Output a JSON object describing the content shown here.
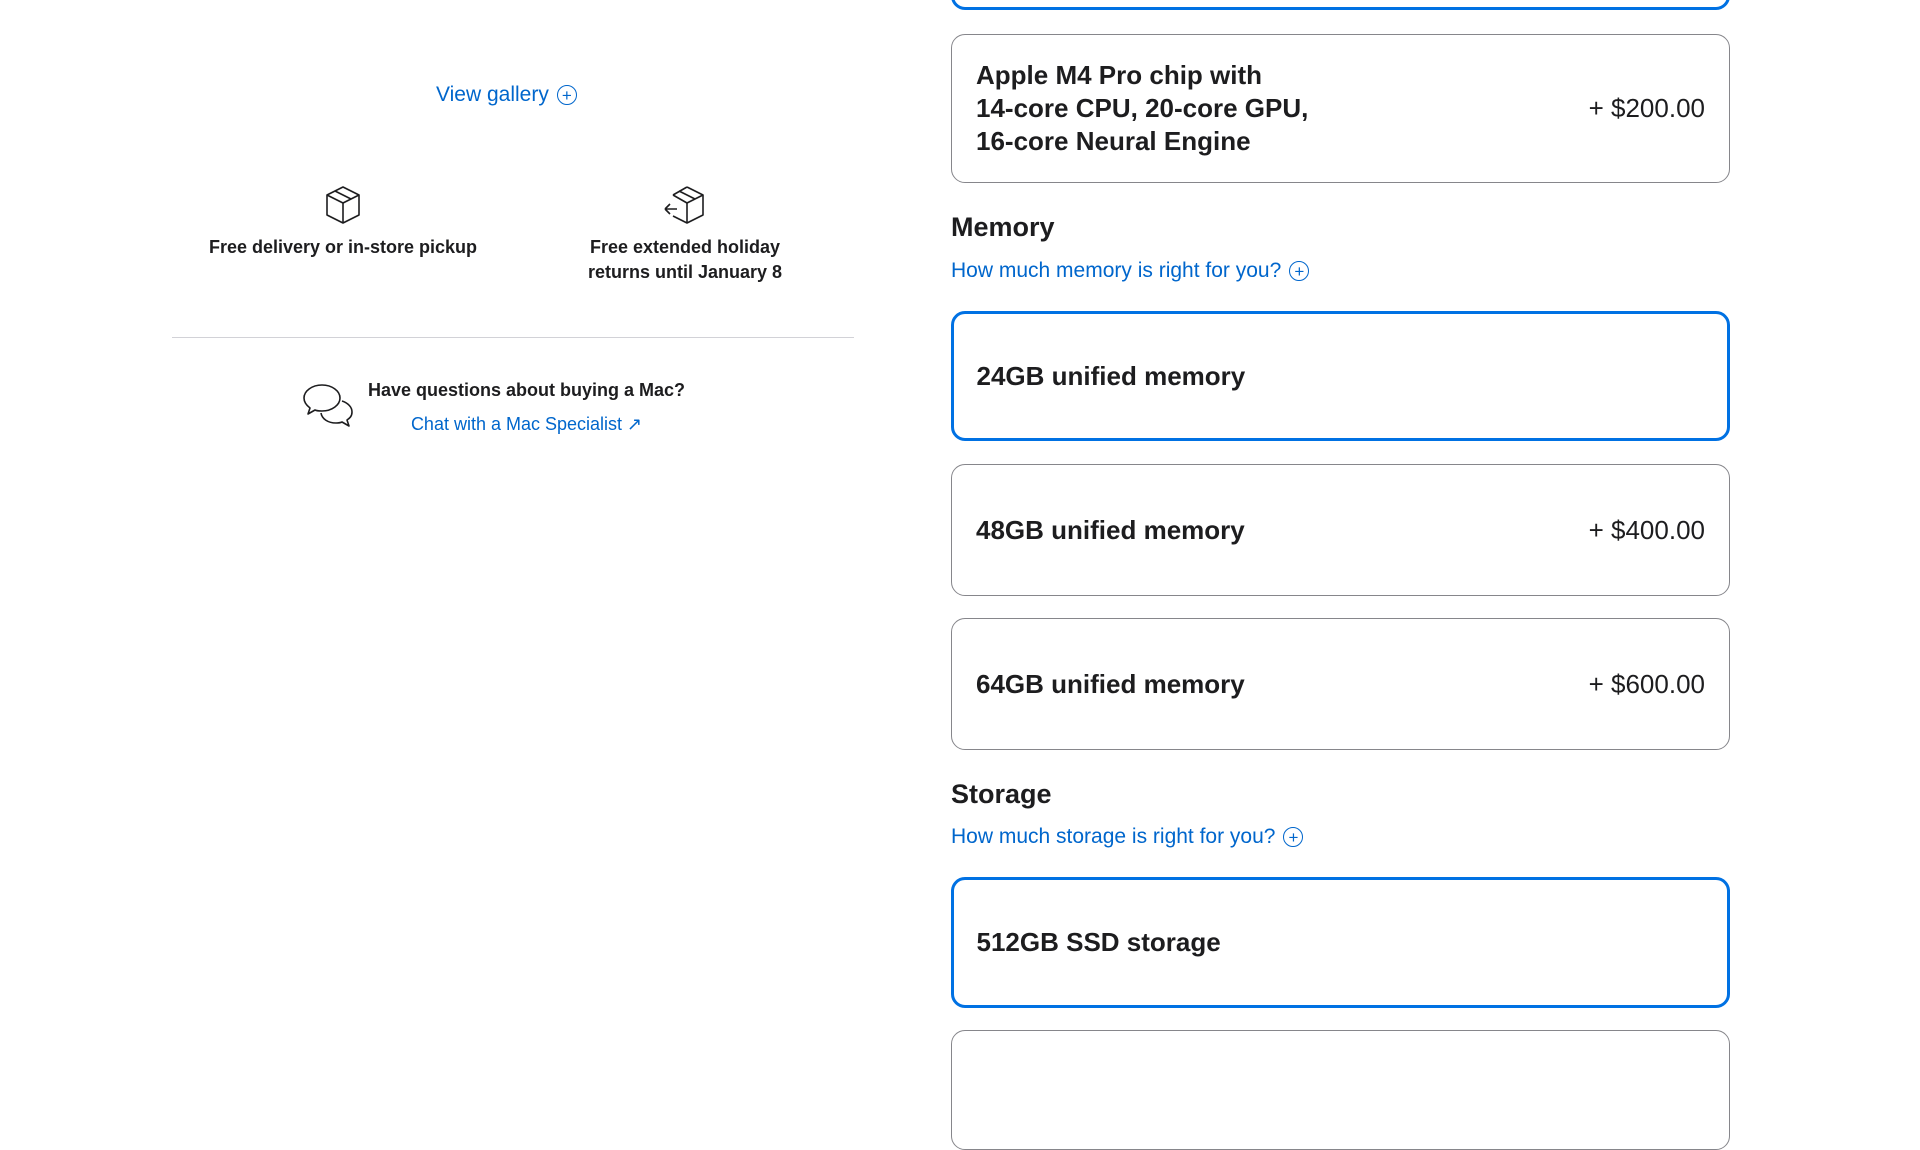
{
  "gallery": {
    "label": "View gallery"
  },
  "perks": [
    {
      "icon": "box-icon",
      "text": "Free delivery or in-store pickup"
    },
    {
      "icon": "box-return-icon",
      "line1": "Free extended holiday",
      "line2": "returns until January 8"
    }
  ],
  "chat": {
    "icon": "chat-bubbles-icon",
    "question": "Have questions about buying a Mac?",
    "link_label": "Chat with a Mac Specialist ↗"
  },
  "chip_option": {
    "lines": [
      "Apple M4 Pro chip with",
      "14-core CPU, 20-core GPU,",
      "16-core Neural Engine"
    ],
    "price": "+ $200.00"
  },
  "memory": {
    "title": "Memory",
    "help": "How much memory is right for you?",
    "options": [
      {
        "label": "24GB unified memory",
        "price": "",
        "selected": true
      },
      {
        "label": "48GB unified memory",
        "price": "+ $400.00",
        "selected": false
      },
      {
        "label": "64GB unified memory",
        "price": "+ $600.00",
        "selected": false
      }
    ]
  },
  "storage": {
    "title": "Storage",
    "help": "How much storage is right for you?",
    "options": [
      {
        "label": "512GB SSD storage",
        "price": "",
        "selected": true
      }
    ]
  },
  "colors": {
    "accent": "#0066cc",
    "selected_border": "#0071e3",
    "text": "#1d1d1f",
    "border": "#86868b"
  }
}
